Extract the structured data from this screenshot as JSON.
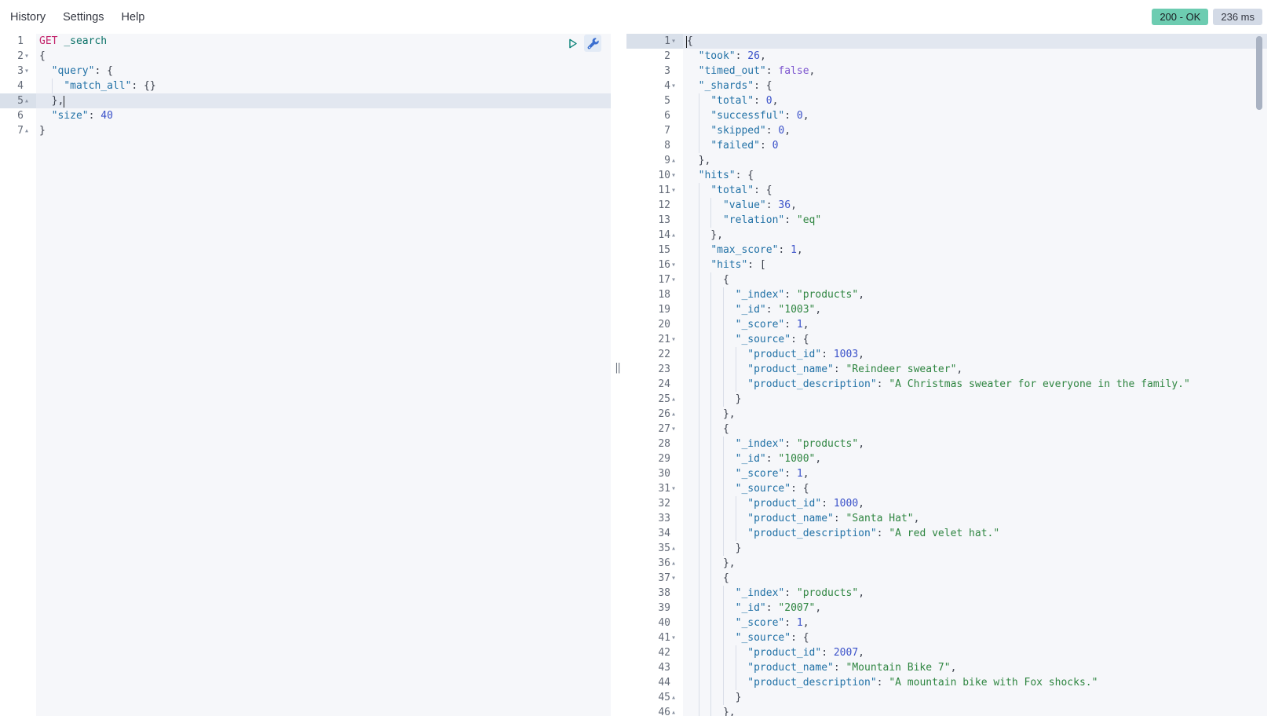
{
  "menu": {
    "items": [
      {
        "label": "History"
      },
      {
        "label": "Settings"
      },
      {
        "label": "Help"
      }
    ]
  },
  "status": {
    "code_label": "200 - OK",
    "time_label": "236 ms",
    "code_bg": "#6dccb1",
    "time_bg": "#d3dae6"
  },
  "icons": {
    "send_request": "play-icon",
    "request_options": "wrench-icon",
    "fold_open": "▾",
    "fold_close": "▴",
    "resize_handle": "‖"
  },
  "colors": {
    "method": "#c4256c",
    "url": "#0b7268",
    "key": "#2171a6",
    "number": "#3a51c9",
    "string": "#2e8540",
    "boolean": "#7a52ce",
    "plain": "#3c414d",
    "editor_bg": "#f6f7fa",
    "gutter_bg": "#ffffff",
    "active_line": "#e2e7f0",
    "active_gutter": "#d9e0ea",
    "line_number": "#646b78",
    "guide": "#d9dee8",
    "fold": "#8a93a2",
    "play": "#017d73",
    "wrench": "#3b6fd0",
    "wrench_bg": "#e3ebf6",
    "scroll_thumb": "#a9b2c2",
    "cursor": "#1d1e20"
  },
  "request_editor": {
    "lines": [
      {
        "n": 1,
        "fold": null,
        "t": [
          [
            "m",
            "GET"
          ],
          [
            "p",
            " "
          ],
          [
            "u",
            "_search"
          ]
        ]
      },
      {
        "n": 2,
        "fold": "down",
        "t": [
          [
            "p",
            "{"
          ]
        ]
      },
      {
        "n": 3,
        "fold": "down",
        "t": [
          [
            "p",
            "  "
          ],
          [
            "k",
            "\"query\""
          ],
          [
            "p",
            ": {"
          ]
        ]
      },
      {
        "n": 4,
        "fold": null,
        "t": [
          [
            "p",
            "    "
          ],
          [
            "k",
            "\"match_all\""
          ],
          [
            "p",
            ": {}"
          ]
        ]
      },
      {
        "n": 5,
        "fold": "up",
        "active": true,
        "cur": "end",
        "t": [
          [
            "p",
            "  },"
          ]
        ]
      },
      {
        "n": 6,
        "fold": null,
        "t": [
          [
            "p",
            "  "
          ],
          [
            "k",
            "\"size\""
          ],
          [
            "p",
            ": "
          ],
          [
            "n",
            "40"
          ]
        ]
      },
      {
        "n": 7,
        "fold": "up",
        "t": [
          [
            "p",
            "}"
          ]
        ]
      }
    ]
  },
  "response_editor": {
    "lines": [
      {
        "n": 1,
        "fold": "down",
        "active": true,
        "cur": "start",
        "t": [
          [
            "p",
            "{"
          ]
        ]
      },
      {
        "n": 2,
        "fold": null,
        "t": [
          [
            "p",
            "  "
          ],
          [
            "k",
            "\"took\""
          ],
          [
            "p",
            ": "
          ],
          [
            "n",
            "26"
          ],
          [
            "p",
            ","
          ]
        ]
      },
      {
        "n": 3,
        "fold": null,
        "t": [
          [
            "p",
            "  "
          ],
          [
            "k",
            "\"timed_out\""
          ],
          [
            "p",
            ": "
          ],
          [
            "b",
            "false"
          ],
          [
            "p",
            ","
          ]
        ]
      },
      {
        "n": 4,
        "fold": "down",
        "t": [
          [
            "p",
            "  "
          ],
          [
            "k",
            "\"_shards\""
          ],
          [
            "p",
            ": {"
          ]
        ]
      },
      {
        "n": 5,
        "fold": null,
        "t": [
          [
            "p",
            "    "
          ],
          [
            "k",
            "\"total\""
          ],
          [
            "p",
            ": "
          ],
          [
            "n",
            "0"
          ],
          [
            "p",
            ","
          ]
        ]
      },
      {
        "n": 6,
        "fold": null,
        "t": [
          [
            "p",
            "    "
          ],
          [
            "k",
            "\"successful\""
          ],
          [
            "p",
            ": "
          ],
          [
            "n",
            "0"
          ],
          [
            "p",
            ","
          ]
        ]
      },
      {
        "n": 7,
        "fold": null,
        "t": [
          [
            "p",
            "    "
          ],
          [
            "k",
            "\"skipped\""
          ],
          [
            "p",
            ": "
          ],
          [
            "n",
            "0"
          ],
          [
            "p",
            ","
          ]
        ]
      },
      {
        "n": 8,
        "fold": null,
        "t": [
          [
            "p",
            "    "
          ],
          [
            "k",
            "\"failed\""
          ],
          [
            "p",
            ": "
          ],
          [
            "n",
            "0"
          ]
        ]
      },
      {
        "n": 9,
        "fold": "up",
        "t": [
          [
            "p",
            "  },"
          ]
        ]
      },
      {
        "n": 10,
        "fold": "down",
        "t": [
          [
            "p",
            "  "
          ],
          [
            "k",
            "\"hits\""
          ],
          [
            "p",
            ": {"
          ]
        ]
      },
      {
        "n": 11,
        "fold": "down",
        "t": [
          [
            "p",
            "    "
          ],
          [
            "k",
            "\"total\""
          ],
          [
            "p",
            ": {"
          ]
        ]
      },
      {
        "n": 12,
        "fold": null,
        "t": [
          [
            "p",
            "      "
          ],
          [
            "k",
            "\"value\""
          ],
          [
            "p",
            ": "
          ],
          [
            "n",
            "36"
          ],
          [
            "p",
            ","
          ]
        ]
      },
      {
        "n": 13,
        "fold": null,
        "t": [
          [
            "p",
            "      "
          ],
          [
            "k",
            "\"relation\""
          ],
          [
            "p",
            ": "
          ],
          [
            "s",
            "\"eq\""
          ]
        ]
      },
      {
        "n": 14,
        "fold": "up",
        "t": [
          [
            "p",
            "    },"
          ]
        ]
      },
      {
        "n": 15,
        "fold": null,
        "t": [
          [
            "p",
            "    "
          ],
          [
            "k",
            "\"max_score\""
          ],
          [
            "p",
            ": "
          ],
          [
            "n",
            "1"
          ],
          [
            "p",
            ","
          ]
        ]
      },
      {
        "n": 16,
        "fold": "down",
        "t": [
          [
            "p",
            "    "
          ],
          [
            "k",
            "\"hits\""
          ],
          [
            "p",
            ": ["
          ]
        ]
      },
      {
        "n": 17,
        "fold": "down",
        "t": [
          [
            "p",
            "      {"
          ]
        ]
      },
      {
        "n": 18,
        "fold": null,
        "t": [
          [
            "p",
            "        "
          ],
          [
            "k",
            "\"_index\""
          ],
          [
            "p",
            ": "
          ],
          [
            "s",
            "\"products\""
          ],
          [
            "p",
            ","
          ]
        ]
      },
      {
        "n": 19,
        "fold": null,
        "t": [
          [
            "p",
            "        "
          ],
          [
            "k",
            "\"_id\""
          ],
          [
            "p",
            ": "
          ],
          [
            "s",
            "\"1003\""
          ],
          [
            "p",
            ","
          ]
        ]
      },
      {
        "n": 20,
        "fold": null,
        "t": [
          [
            "p",
            "        "
          ],
          [
            "k",
            "\"_score\""
          ],
          [
            "p",
            ": "
          ],
          [
            "n",
            "1"
          ],
          [
            "p",
            ","
          ]
        ]
      },
      {
        "n": 21,
        "fold": "down",
        "t": [
          [
            "p",
            "        "
          ],
          [
            "k",
            "\"_source\""
          ],
          [
            "p",
            ": {"
          ]
        ]
      },
      {
        "n": 22,
        "fold": null,
        "t": [
          [
            "p",
            "          "
          ],
          [
            "k",
            "\"product_id\""
          ],
          [
            "p",
            ": "
          ],
          [
            "n",
            "1003"
          ],
          [
            "p",
            ","
          ]
        ]
      },
      {
        "n": 23,
        "fold": null,
        "t": [
          [
            "p",
            "          "
          ],
          [
            "k",
            "\"product_name\""
          ],
          [
            "p",
            ": "
          ],
          [
            "s",
            "\"Reindeer sweater\""
          ],
          [
            "p",
            ","
          ]
        ]
      },
      {
        "n": 24,
        "fold": null,
        "t": [
          [
            "p",
            "          "
          ],
          [
            "k",
            "\"product_description\""
          ],
          [
            "p",
            ": "
          ],
          [
            "s",
            "\"A Christmas sweater for everyone in the family.\""
          ]
        ]
      },
      {
        "n": 25,
        "fold": "up",
        "t": [
          [
            "p",
            "        }"
          ]
        ]
      },
      {
        "n": 26,
        "fold": "up",
        "t": [
          [
            "p",
            "      },"
          ]
        ]
      },
      {
        "n": 27,
        "fold": "down",
        "t": [
          [
            "p",
            "      {"
          ]
        ]
      },
      {
        "n": 28,
        "fold": null,
        "t": [
          [
            "p",
            "        "
          ],
          [
            "k",
            "\"_index\""
          ],
          [
            "p",
            ": "
          ],
          [
            "s",
            "\"products\""
          ],
          [
            "p",
            ","
          ]
        ]
      },
      {
        "n": 29,
        "fold": null,
        "t": [
          [
            "p",
            "        "
          ],
          [
            "k",
            "\"_id\""
          ],
          [
            "p",
            ": "
          ],
          [
            "s",
            "\"1000\""
          ],
          [
            "p",
            ","
          ]
        ]
      },
      {
        "n": 30,
        "fold": null,
        "t": [
          [
            "p",
            "        "
          ],
          [
            "k",
            "\"_score\""
          ],
          [
            "p",
            ": "
          ],
          [
            "n",
            "1"
          ],
          [
            "p",
            ","
          ]
        ]
      },
      {
        "n": 31,
        "fold": "down",
        "t": [
          [
            "p",
            "        "
          ],
          [
            "k",
            "\"_source\""
          ],
          [
            "p",
            ": {"
          ]
        ]
      },
      {
        "n": 32,
        "fold": null,
        "t": [
          [
            "p",
            "          "
          ],
          [
            "k",
            "\"product_id\""
          ],
          [
            "p",
            ": "
          ],
          [
            "n",
            "1000"
          ],
          [
            "p",
            ","
          ]
        ]
      },
      {
        "n": 33,
        "fold": null,
        "t": [
          [
            "p",
            "          "
          ],
          [
            "k",
            "\"product_name\""
          ],
          [
            "p",
            ": "
          ],
          [
            "s",
            "\"Santa Hat\""
          ],
          [
            "p",
            ","
          ]
        ]
      },
      {
        "n": 34,
        "fold": null,
        "t": [
          [
            "p",
            "          "
          ],
          [
            "k",
            "\"product_description\""
          ],
          [
            "p",
            ": "
          ],
          [
            "s",
            "\"A red velet hat.\""
          ]
        ]
      },
      {
        "n": 35,
        "fold": "up",
        "t": [
          [
            "p",
            "        }"
          ]
        ]
      },
      {
        "n": 36,
        "fold": "up",
        "t": [
          [
            "p",
            "      },"
          ]
        ]
      },
      {
        "n": 37,
        "fold": "down",
        "t": [
          [
            "p",
            "      {"
          ]
        ]
      },
      {
        "n": 38,
        "fold": null,
        "t": [
          [
            "p",
            "        "
          ],
          [
            "k",
            "\"_index\""
          ],
          [
            "p",
            ": "
          ],
          [
            "s",
            "\"products\""
          ],
          [
            "p",
            ","
          ]
        ]
      },
      {
        "n": 39,
        "fold": null,
        "t": [
          [
            "p",
            "        "
          ],
          [
            "k",
            "\"_id\""
          ],
          [
            "p",
            ": "
          ],
          [
            "s",
            "\"2007\""
          ],
          [
            "p",
            ","
          ]
        ]
      },
      {
        "n": 40,
        "fold": null,
        "t": [
          [
            "p",
            "        "
          ],
          [
            "k",
            "\"_score\""
          ],
          [
            "p",
            ": "
          ],
          [
            "n",
            "1"
          ],
          [
            "p",
            ","
          ]
        ]
      },
      {
        "n": 41,
        "fold": "down",
        "t": [
          [
            "p",
            "        "
          ],
          [
            "k",
            "\"_source\""
          ],
          [
            "p",
            ": {"
          ]
        ]
      },
      {
        "n": 42,
        "fold": null,
        "t": [
          [
            "p",
            "          "
          ],
          [
            "k",
            "\"product_id\""
          ],
          [
            "p",
            ": "
          ],
          [
            "n",
            "2007"
          ],
          [
            "p",
            ","
          ]
        ]
      },
      {
        "n": 43,
        "fold": null,
        "t": [
          [
            "p",
            "          "
          ],
          [
            "k",
            "\"product_name\""
          ],
          [
            "p",
            ": "
          ],
          [
            "s",
            "\"Mountain Bike 7\""
          ],
          [
            "p",
            ","
          ]
        ]
      },
      {
        "n": 44,
        "fold": null,
        "t": [
          [
            "p",
            "          "
          ],
          [
            "k",
            "\"product_description\""
          ],
          [
            "p",
            ": "
          ],
          [
            "s",
            "\"A mountain bike with Fox shocks.\""
          ]
        ]
      },
      {
        "n": 45,
        "fold": "up",
        "t": [
          [
            "p",
            "        }"
          ]
        ]
      },
      {
        "n": 46,
        "fold": "up",
        "t": [
          [
            "p",
            "      },"
          ]
        ]
      }
    ]
  }
}
